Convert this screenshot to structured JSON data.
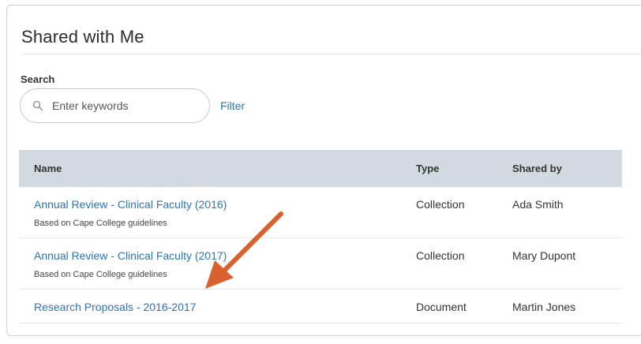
{
  "page": {
    "title": "Shared with Me"
  },
  "search": {
    "label": "Search",
    "placeholder": "Enter keywords",
    "value": "",
    "icon": "search-icon"
  },
  "filter": {
    "label": "Filter"
  },
  "table": {
    "headers": {
      "name": "Name",
      "type": "Type",
      "shared_by": "Shared by"
    },
    "rows": [
      {
        "title": "Annual Review - Clinical Faculty (2016)",
        "subtitle": "Based on Cape College guidelines",
        "type": "Collection",
        "shared_by": "Ada Smith"
      },
      {
        "title": "Annual Review - Clinical Faculty (2017)",
        "subtitle": "Based on Cape College guidelines",
        "type": "Collection",
        "shared_by": "Mary Dupont"
      },
      {
        "title": "Research Proposals - 2016-2017",
        "subtitle": "",
        "type": "Document",
        "shared_by": "Martin Jones"
      }
    ]
  },
  "colors": {
    "link": "#2e74b5",
    "header_bg": "#d3d9e1",
    "annotation_arrow": "#d9612e"
  }
}
